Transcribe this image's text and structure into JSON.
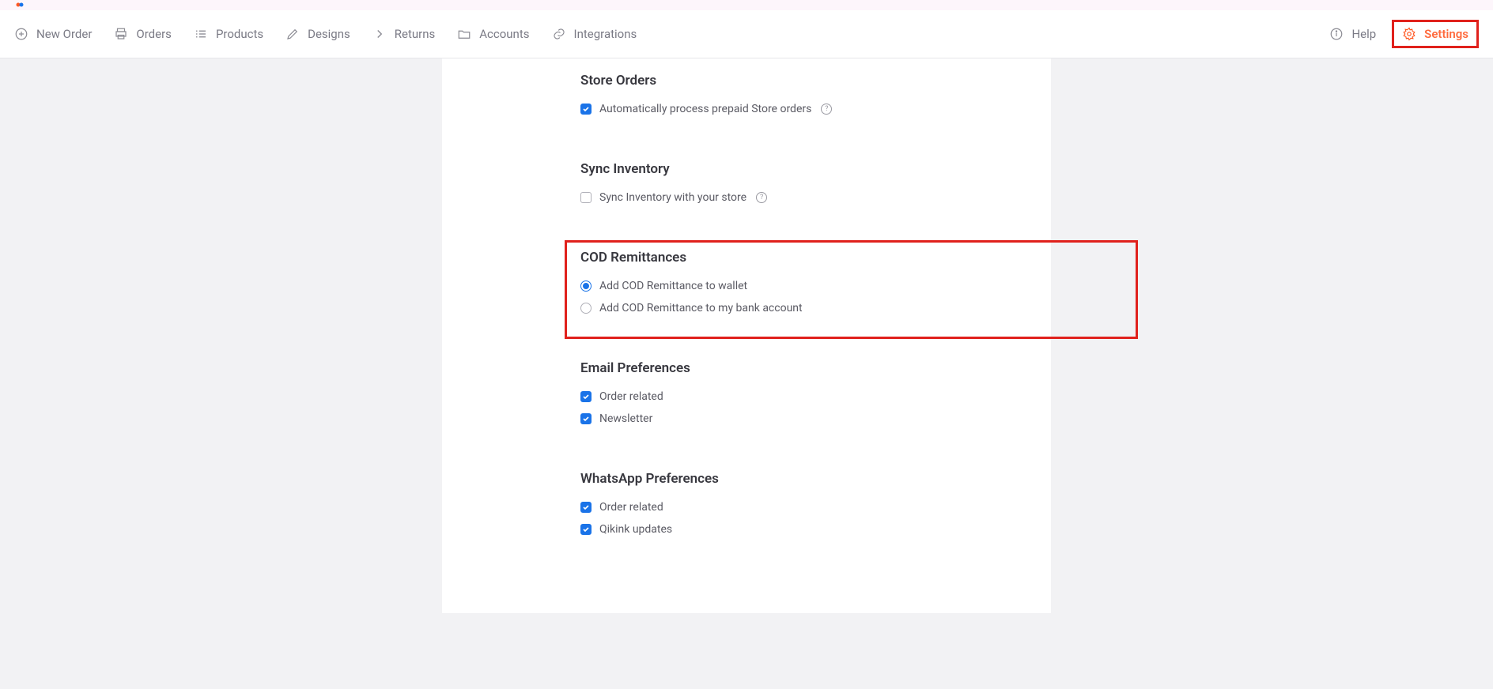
{
  "nav": {
    "left": [
      {
        "label": "New Order",
        "icon": "plus-circle"
      },
      {
        "label": "Orders",
        "icon": "printer"
      },
      {
        "label": "Products",
        "icon": "list"
      },
      {
        "label": "Designs",
        "icon": "pencil"
      },
      {
        "label": "Returns",
        "icon": "chevron-right"
      },
      {
        "label": "Accounts",
        "icon": "folder"
      },
      {
        "label": "Integrations",
        "icon": "link"
      }
    ],
    "right": [
      {
        "label": "Help",
        "icon": "info"
      },
      {
        "label": "Settings",
        "icon": "gear",
        "active": true
      }
    ]
  },
  "sections": {
    "storeOrders": {
      "title": "Store Orders",
      "opt1": "Automatically process prepaid Store orders"
    },
    "syncInventory": {
      "title": "Sync Inventory",
      "opt1": "Sync Inventory with your store"
    },
    "codRemittances": {
      "title": "COD Remittances",
      "opt1": "Add COD Remittance to wallet",
      "opt2": "Add COD Remittance to my bank account"
    },
    "emailPrefs": {
      "title": "Email Preferences",
      "opt1": "Order related",
      "opt2": "Newsletter"
    },
    "whatsappPrefs": {
      "title": "WhatsApp Preferences",
      "opt1": "Order related",
      "opt2": "Qikink updates"
    }
  }
}
